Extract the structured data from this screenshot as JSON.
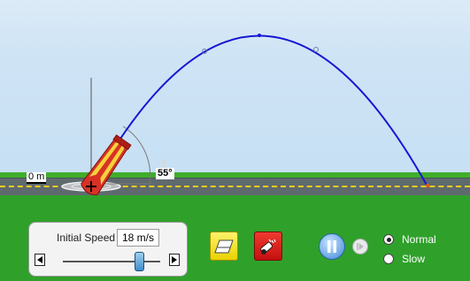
{
  "scene": {
    "ruler_label": "0 m",
    "angle_label": "55°"
  },
  "speed_control": {
    "label": "Initial Speed",
    "value": "18 m/s",
    "slider_fraction": 0.79
  },
  "playback": {
    "speed_options": [
      "Normal",
      "Slow"
    ],
    "selected_speed": "Normal"
  },
  "colors": {
    "trajectory": "#1717d4",
    "sky": "#cfe4f5",
    "grass": "#2fa12a",
    "road": "#5f6a6e",
    "road_dash": "#f3cc20"
  },
  "icons": {
    "eraser_button": "eraser-icon",
    "fire_button": "cannon-fire-icon",
    "pause_button": "pause-icon",
    "step_button": "step-forward-icon"
  }
}
